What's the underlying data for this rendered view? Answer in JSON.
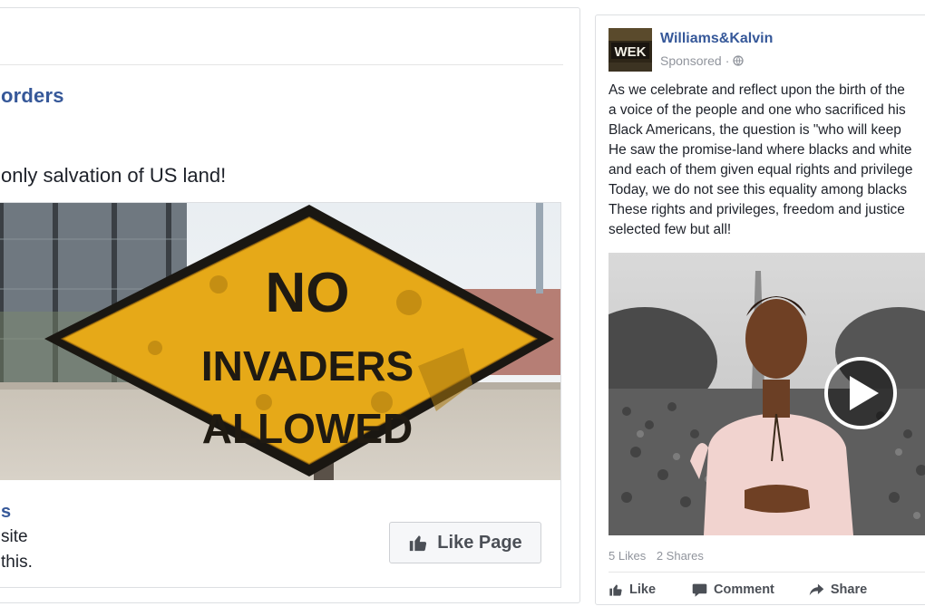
{
  "left_post": {
    "page_name": "orders",
    "text": "only salvation of US land!",
    "ad": {
      "sign_text": [
        "NO",
        "INVADERS",
        "ALLOWED"
      ],
      "name": "s",
      "line1": "site",
      "line2": "this.",
      "button_label": "Like Page"
    }
  },
  "right_post": {
    "avatar_text": "WEK",
    "author": "Williams&Kalvin",
    "sponsored": "Sponsored",
    "separator": "·",
    "body_lines": [
      "As we celebrate and reflect upon the birth of the",
      "a voice of the people and one who sacrificed his",
      "Black Americans, the question is \"who will keep",
      "He saw the promise-land where blacks and white",
      "and each of them given equal rights and privilege",
      "Today, we do not see this equality among blacks",
      "These rights and privileges, freedom and justice",
      "selected few but all!"
    ],
    "likes": "5 Likes",
    "shares": "2 Shares",
    "actions": {
      "like": "Like",
      "comment": "Comment",
      "share": "Share"
    }
  },
  "colors": {
    "link_blue": "#365899",
    "sign_yellow": "#e6a918",
    "border": "#dddfe2",
    "muted_text": "#90949c"
  }
}
